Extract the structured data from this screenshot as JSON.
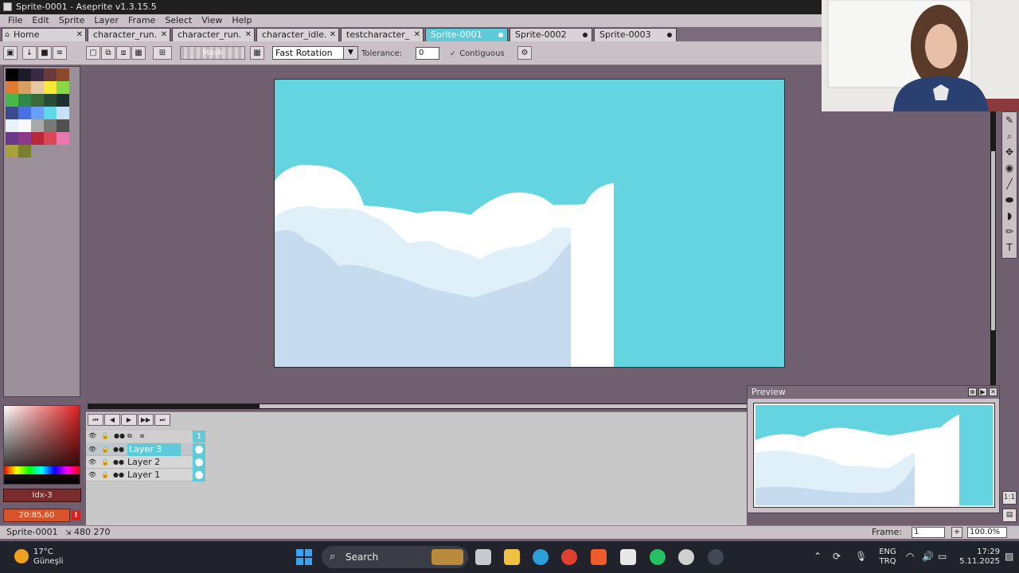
{
  "window": {
    "title": "Sprite-0001 - Aseprite v1.3.15.5"
  },
  "menu": [
    "File",
    "Edit",
    "Sprite",
    "Layer",
    "Frame",
    "Select",
    "View",
    "Help"
  ],
  "tabs": [
    {
      "label": "Home",
      "icon": "home-icon",
      "close": "✕"
    },
    {
      "label": "character_run.",
      "close": "✕"
    },
    {
      "label": "character_run.",
      "close": "✕"
    },
    {
      "label": "character_idle.",
      "close": "✕"
    },
    {
      "label": "testcharacter_",
      "close": "✕"
    },
    {
      "label": "Sprite-0001",
      "active": true
    },
    {
      "label": "Sprite-0002"
    },
    {
      "label": "Sprite-0003"
    }
  ],
  "toolbar": {
    "mask_label": "Mask",
    "rotation_select": "Fast Rotation",
    "tolerance_label": "Tolerance:",
    "tolerance_value": "0",
    "contiguous_label": "Contiguous",
    "contiguous_checked": true
  },
  "palette": [
    "#000000",
    "#1e1a2a",
    "#3a2a44",
    "#6a3a3a",
    "#8a4a2a",
    "#e07a30",
    "#d8a060",
    "#e8c8a0",
    "#f8e838",
    "#88d848",
    "#48b848",
    "#308848",
    "#3a6a3a",
    "#2a4a3a",
    "#203030",
    "#3a4a8a",
    "#4870e0",
    "#68a0f8",
    "#60d8e8",
    "#c8e0f8",
    "#e8f0f8",
    "#f8f8f8",
    "#a8a8a8",
    "#787878",
    "#505050",
    "#6a3a8a",
    "#8a3a8a",
    "#b82838",
    "#d84858",
    "#e878b0",
    "#a8a040",
    "#788030"
  ],
  "color": {
    "index_label": "Idx-3",
    "hex_label": "20:85,60",
    "fg": "#7a2b2b"
  },
  "layers": [
    {
      "name": "Layer 3",
      "selected": true
    },
    {
      "name": "Layer 2",
      "selected": false
    },
    {
      "name": "Layer 1",
      "selected": false
    }
  ],
  "timeline": {
    "frame_header": "1"
  },
  "preview": {
    "title": "Preview"
  },
  "status": {
    "sprite_name": "Sprite-0001",
    "size": "480 270",
    "frame_label": "Frame:",
    "frame_value": "1",
    "zoom": "100.0%"
  },
  "taskbar": {
    "temp": "17°C",
    "weather": "Güneşli",
    "search": "Search",
    "lang1": "ENG",
    "lang2": "TRQ",
    "time": "17:29",
    "date": "5.11.2025"
  },
  "colors": {
    "sky": "#64d5e0",
    "cloud_white": "#ffffff",
    "cloud_light": "#dff0f8",
    "cloud_shadow": "#c6dcee",
    "accent": "#5fcbd8"
  }
}
